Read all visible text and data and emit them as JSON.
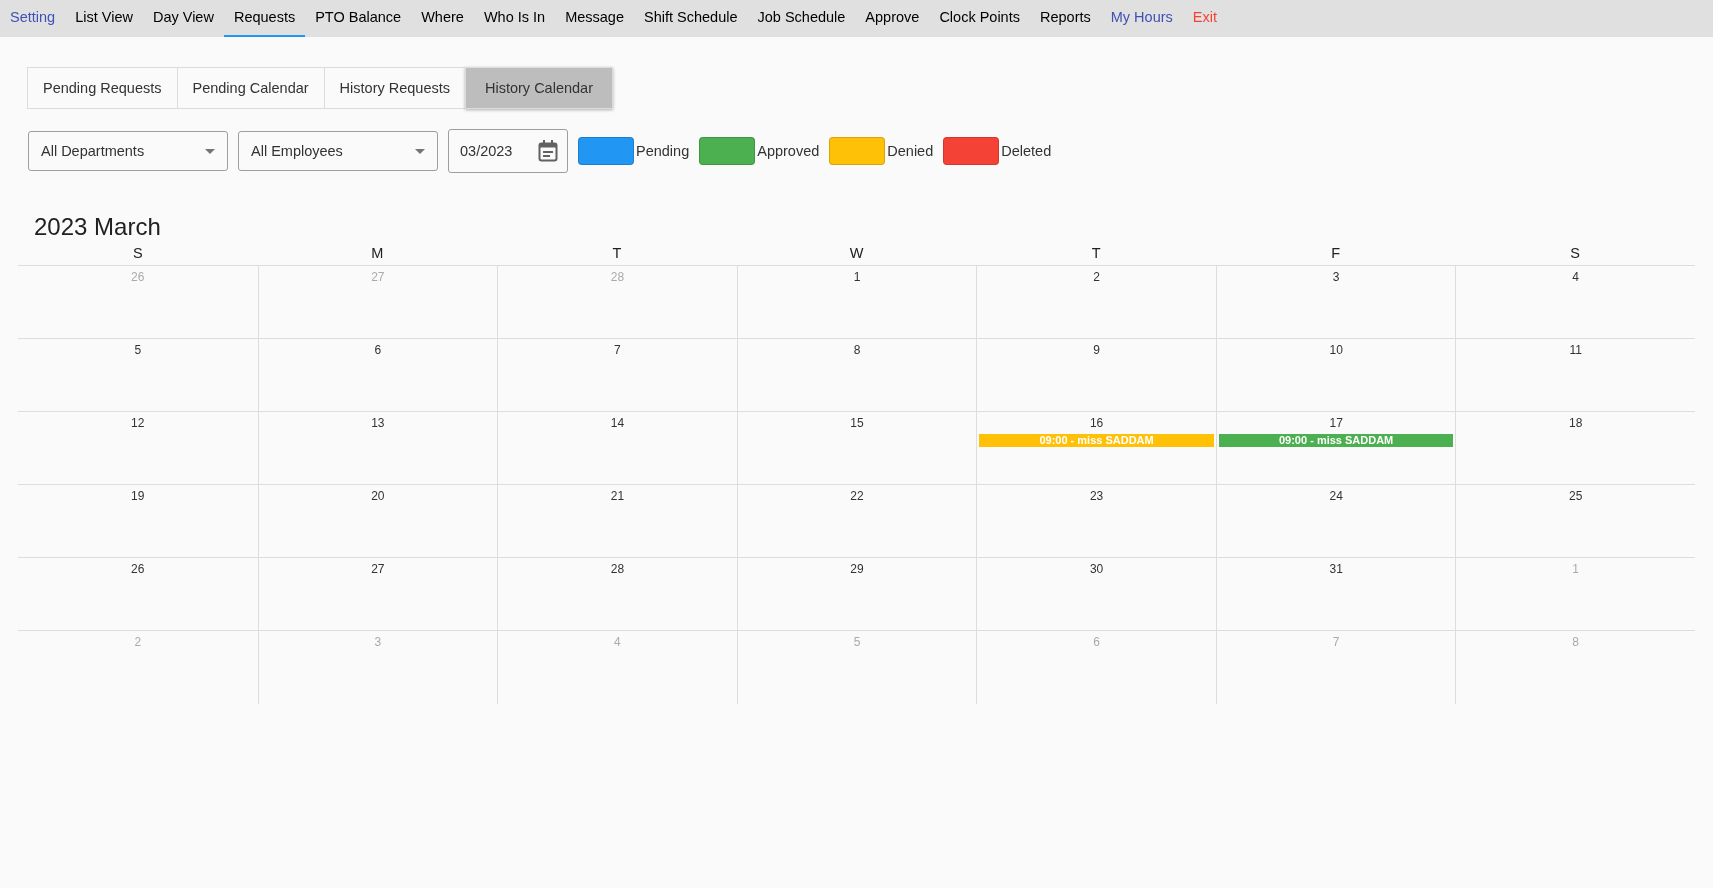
{
  "nav": [
    {
      "label": "Setting",
      "selected": false,
      "color": "#3f51b5"
    },
    {
      "label": "List View",
      "selected": false,
      "color": "#000000"
    },
    {
      "label": "Day View",
      "selected": false,
      "color": "#000000"
    },
    {
      "label": "Requests",
      "selected": true,
      "color": "#000000"
    },
    {
      "label": "PTO Balance",
      "selected": false,
      "color": "#000000"
    },
    {
      "label": "Where",
      "selected": false,
      "color": "#000000"
    },
    {
      "label": "Who Is In",
      "selected": false,
      "color": "#000000"
    },
    {
      "label": "Message",
      "selected": false,
      "color": "#000000"
    },
    {
      "label": "Shift Schedule",
      "selected": false,
      "color": "#000000"
    },
    {
      "label": "Job Schedule",
      "selected": false,
      "color": "#000000"
    },
    {
      "label": "Approve",
      "selected": false,
      "color": "#000000"
    },
    {
      "label": "Clock Points",
      "selected": false,
      "color": "#000000"
    },
    {
      "label": "Reports",
      "selected": false,
      "color": "#000000"
    },
    {
      "label": "My Hours",
      "selected": false,
      "color": "#3f51b5"
    },
    {
      "label": "Exit",
      "selected": false,
      "color": "#f44336"
    }
  ],
  "tabs": [
    {
      "label": "Pending Requests",
      "selected": false
    },
    {
      "label": "Pending Calendar",
      "selected": false
    },
    {
      "label": "History Requests",
      "selected": false
    },
    {
      "label": "History Calendar",
      "selected": true
    }
  ],
  "filters": {
    "department": "All Departments",
    "employee": "All Employees",
    "month": "03/2023"
  },
  "legend": [
    {
      "label": "Pending",
      "color": "#2196f3"
    },
    {
      "label": "Approved",
      "color": "#4caf50"
    },
    {
      "label": "Denied",
      "color": "#ffc107"
    },
    {
      "label": "Deleted",
      "color": "#f44336"
    }
  ],
  "calendar": {
    "title": "2023 March",
    "weekdays": [
      "S",
      "M",
      "T",
      "W",
      "T",
      "F",
      "S"
    ],
    "weeks": [
      [
        {
          "day": "26",
          "muted": true
        },
        {
          "day": "27",
          "muted": true
        },
        {
          "day": "28",
          "muted": true
        },
        {
          "day": "1",
          "muted": false
        },
        {
          "day": "2",
          "muted": false
        },
        {
          "day": "3",
          "muted": false
        },
        {
          "day": "4",
          "muted": false
        }
      ],
      [
        {
          "day": "5",
          "muted": false
        },
        {
          "day": "6",
          "muted": false
        },
        {
          "day": "7",
          "muted": false
        },
        {
          "day": "8",
          "muted": false
        },
        {
          "day": "9",
          "muted": false
        },
        {
          "day": "10",
          "muted": false
        },
        {
          "day": "11",
          "muted": false
        }
      ],
      [
        {
          "day": "12",
          "muted": false
        },
        {
          "day": "13",
          "muted": false
        },
        {
          "day": "14",
          "muted": false
        },
        {
          "day": "15",
          "muted": false
        },
        {
          "day": "16",
          "muted": false,
          "events": [
            {
              "text": "09:00 - miss SADDAM",
              "color": "#ffc107"
            }
          ]
        },
        {
          "day": "17",
          "muted": false,
          "events": [
            {
              "text": "09:00 - miss SADDAM",
              "color": "#4caf50"
            }
          ]
        },
        {
          "day": "18",
          "muted": false
        }
      ],
      [
        {
          "day": "19",
          "muted": false
        },
        {
          "day": "20",
          "muted": false
        },
        {
          "day": "21",
          "muted": false
        },
        {
          "day": "22",
          "muted": false
        },
        {
          "day": "23",
          "muted": false
        },
        {
          "day": "24",
          "muted": false
        },
        {
          "day": "25",
          "muted": false
        }
      ],
      [
        {
          "day": "26",
          "muted": false
        },
        {
          "day": "27",
          "muted": false
        },
        {
          "day": "28",
          "muted": false
        },
        {
          "day": "29",
          "muted": false
        },
        {
          "day": "30",
          "muted": false
        },
        {
          "day": "31",
          "muted": false
        },
        {
          "day": "1",
          "muted": true
        }
      ],
      [
        {
          "day": "2",
          "muted": true
        },
        {
          "day": "3",
          "muted": true
        },
        {
          "day": "4",
          "muted": true
        },
        {
          "day": "5",
          "muted": true
        },
        {
          "day": "6",
          "muted": true
        },
        {
          "day": "7",
          "muted": true
        },
        {
          "day": "8",
          "muted": true
        }
      ]
    ]
  }
}
